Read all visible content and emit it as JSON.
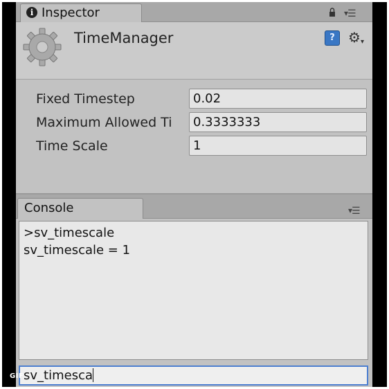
{
  "inspector": {
    "tab_label": "Inspector",
    "component_title": "TimeManager",
    "properties": [
      {
        "label": "Fixed Timestep",
        "value": "0.02"
      },
      {
        "label": "Maximum Allowed Ti",
        "value": "0.3333333"
      },
      {
        "label": "Time Scale",
        "value": "1"
      }
    ],
    "icons": [
      "info-icon",
      "lock-icon",
      "panel-menu-icon",
      "gear-icon",
      "help-icon",
      "settings-icon"
    ]
  },
  "console": {
    "tab_label": "Console",
    "lines": [
      ">sv_timescale",
      "sv_timescale = 1"
    ],
    "input_value": "sv_timesca"
  },
  "badge": "GIF",
  "colors": {
    "focus_border": "#4d7fd0",
    "panel_bg": "#c2c2c2",
    "help_icon_bg": "#3a77c4"
  }
}
